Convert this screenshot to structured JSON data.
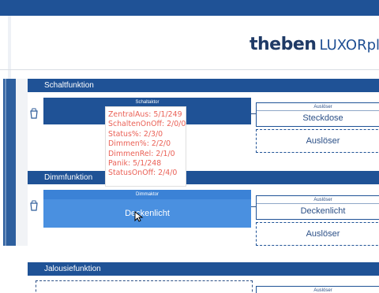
{
  "logo": {
    "brand": "theben",
    "product": "LUXORplu"
  },
  "sections": {
    "switch": {
      "label": "Schaltfunktion"
    },
    "dim": {
      "label": "Dimmfunktion"
    },
    "blind": {
      "label": "Jalousiefunktion"
    }
  },
  "switch_row": {
    "actor_title": "Schaltaktor",
    "actor_name": "",
    "trigger_title": "Auslöser",
    "trigger_name": "Steckdose",
    "empty_trigger_label": "Auslöser"
  },
  "dim_row": {
    "actor_title": "Dimmaktor",
    "actor_name": "Deckenlicht",
    "trigger_title": "Auslöser",
    "trigger_name": "Deckenlicht",
    "empty_trigger_label": "Auslöser"
  },
  "blind_row": {
    "trigger_title": "Auslöser"
  },
  "tooltip": {
    "lines": [
      "ZentralAus: 5/1/249",
      "SchaltenOnOff: 2/0/0",
      "Status%: 2/3/0",
      "Dimmen%: 2/2/0",
      "DimmenRel: 2/1/0",
      "Panik: 5/1/248",
      "StatusOnOff: 2/4/0"
    ]
  },
  "colors": {
    "primary": "#1f5296",
    "highlight": "#4a90e0",
    "tooltip_text": "#ea6157"
  },
  "icons": {
    "row_icon": "bucket-trash-icon",
    "cursor": "mouse-pointer-icon"
  }
}
